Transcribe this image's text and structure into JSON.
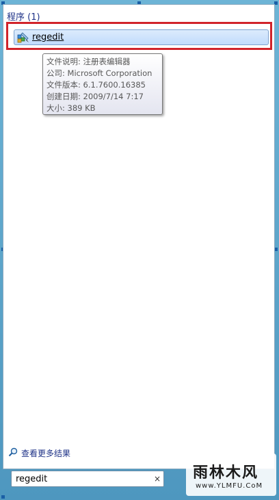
{
  "results": {
    "section_title": "程序 (1)",
    "item_label": "regedit",
    "item_icon": "registry-editor-icon"
  },
  "tooltip": {
    "lines": [
      "文件说明: 注册表编辑器",
      "公司: Microsoft Corporation",
      "文件版本: 6.1.7600.16385",
      "创建日期: 2009/7/14 7:17",
      "大小: 389 KB"
    ]
  },
  "more_results": {
    "label": "查看更多结果",
    "icon": "search-icon"
  },
  "search": {
    "value": "regedit",
    "clear_glyph": "×"
  },
  "watermark": {
    "brand_text": "雨林木风",
    "url_text": "www.YLMFU.CoM"
  },
  "colors": {
    "highlight_border": "#d1232a",
    "section_title": "#1e3287",
    "selection_fill": "#c1dbfc"
  }
}
